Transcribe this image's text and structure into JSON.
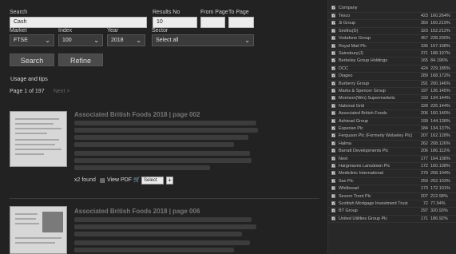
{
  "search": {
    "search_label": "Search",
    "search_value": "Cash",
    "results_no_label": "Results No",
    "results_no_value": "10",
    "from_page_label": "From Page",
    "to_page_label": "To Page",
    "market_label": "Market",
    "market_value": "FTSE",
    "index_label": "Index",
    "index_value": "100",
    "year_label": "Year",
    "year_value": "2018",
    "sector_label": "Sector",
    "sector_value": "Select all",
    "search_button": "Search",
    "refine_button": "Refine",
    "usage_tips": "Usage and tips",
    "page_status": "Page 1 of 197",
    "next_link": "Next >"
  },
  "results": [
    {
      "title": "Associated British Foods 2018 | page 002",
      "found": "x2 found",
      "view_pdf": "View PDF",
      "select_label": "Select",
      "add_label": "+"
    },
    {
      "title": "Associated British Foods 2018 | page 006"
    }
  ],
  "sidebar": {
    "header": {
      "company": "Company"
    },
    "rows": [
      {
        "name": "Tesco",
        "value": "423",
        "pct": "160.264%"
      },
      {
        "name": "3i Group",
        "value": "350",
        "pct": "160.219%"
      },
      {
        "name": "Smiths(D)",
        "value": "323",
        "pct": "152.212%"
      },
      {
        "name": "Vodafone Group",
        "value": "457",
        "pct": "228.200%"
      },
      {
        "name": "Royal Mail Plc",
        "value": "336",
        "pct": "167.198%"
      },
      {
        "name": "Sainsbury(J)",
        "value": "371",
        "pct": "188.197%"
      },
      {
        "name": "Berkeley Group Holdings",
        "value": "165",
        "pct": "84.196%"
      },
      {
        "name": "DCC",
        "value": "424",
        "pct": "229.185%"
      },
      {
        "name": "Diageo",
        "value": "289",
        "pct": "168.172%"
      },
      {
        "name": "Burberry Group",
        "value": "291",
        "pct": "200.146%"
      },
      {
        "name": "Marks & Spencer Group",
        "value": "197",
        "pct": "136.145%"
      },
      {
        "name": "Morrison(Wm) Supermarkets",
        "value": "193",
        "pct": "134.144%"
      },
      {
        "name": "National Grid",
        "value": "328",
        "pct": "226.144%"
      },
      {
        "name": "Associated British Foods",
        "value": "206",
        "pct": "160.140%"
      },
      {
        "name": "Ashtead Group",
        "value": "199",
        "pct": "144.138%"
      },
      {
        "name": "Experian Plc",
        "value": "184",
        "pct": "134.137%"
      },
      {
        "name": "Ferguson Plc (Formerly Wolseley Plc)",
        "value": "207",
        "pct": "162.128%"
      },
      {
        "name": "Halma",
        "value": "262",
        "pct": "208.126%"
      },
      {
        "name": "Barratt Developments Plc",
        "value": "206",
        "pct": "186.112%"
      },
      {
        "name": "Next",
        "value": "177",
        "pct": "164.108%"
      },
      {
        "name": "Hargreaves Lansdown Plc",
        "value": "172",
        "pct": "160.108%"
      },
      {
        "name": "Mediclinic International",
        "value": "279",
        "pct": "268.104%"
      },
      {
        "name": "Sse Plc",
        "value": "259",
        "pct": "252.103%"
      },
      {
        "name": "Whitbread",
        "value": "173",
        "pct": "172.101%"
      },
      {
        "name": "Severn Trent Plc",
        "value": "207",
        "pct": "212.98%"
      },
      {
        "name": "Scottish Mortgage Investment Trust",
        "value": "72",
        "pct": "77.94%"
      },
      {
        "name": "BT Group",
        "value": "297",
        "pct": "320.93%"
      },
      {
        "name": "United Utilities Group Plc",
        "value": "171",
        "pct": "186.92%"
      }
    ]
  }
}
